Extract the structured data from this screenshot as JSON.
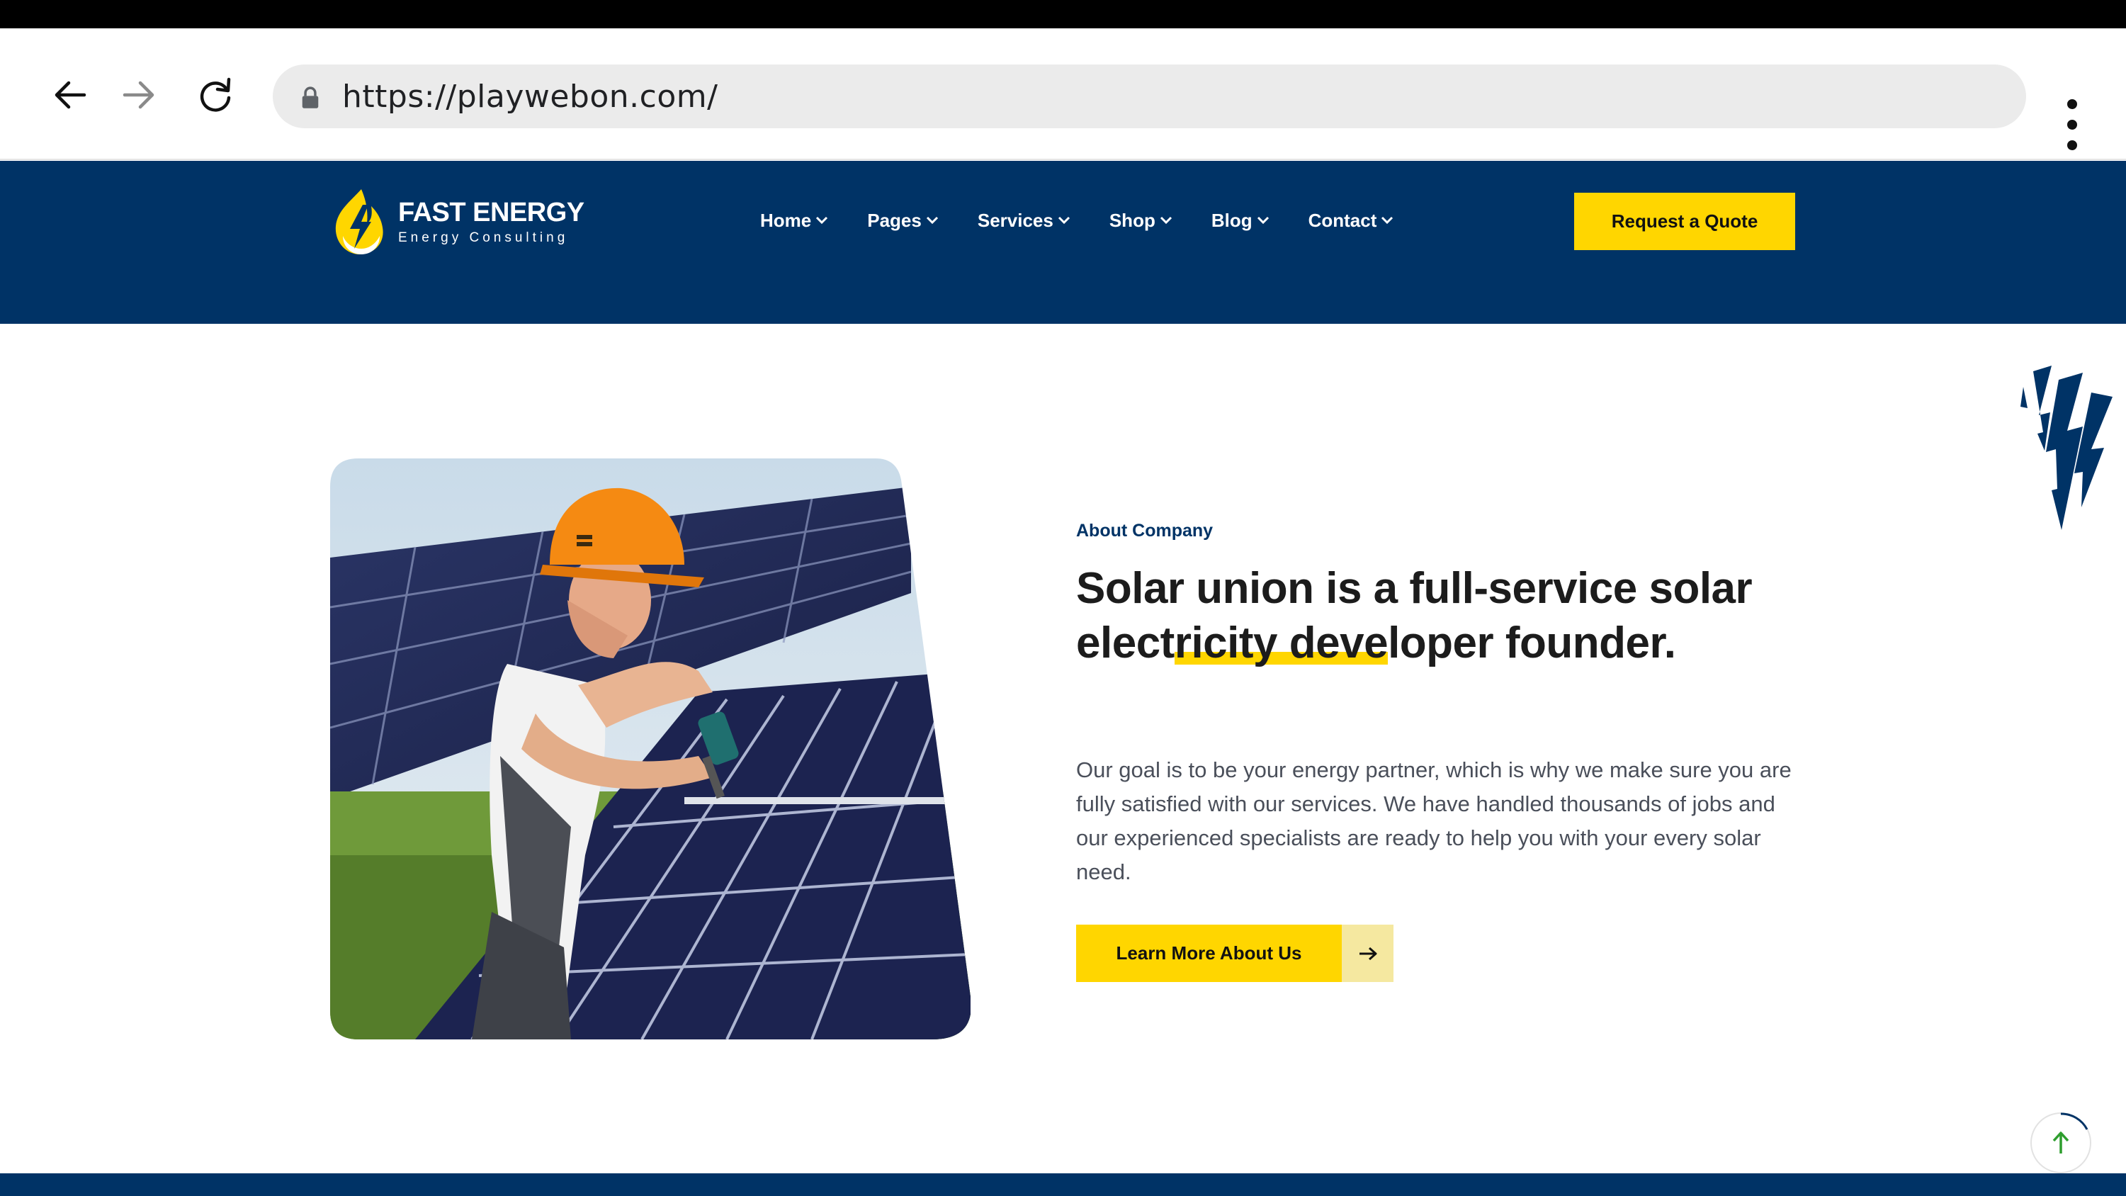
{
  "browser": {
    "url": "https://playwebon.com/",
    "icons": [
      "back-arrow-icon",
      "forward-arrow-icon",
      "reload-icon",
      "lock-icon",
      "menu-dots-icon"
    ]
  },
  "header": {
    "logo_title": "FAST ENERGY",
    "logo_subtitle": "Energy Consulting",
    "nav": [
      {
        "label": "Home"
      },
      {
        "label": "Pages"
      },
      {
        "label": "Services"
      },
      {
        "label": "Shop"
      },
      {
        "label": "Blog"
      },
      {
        "label": "Contact"
      }
    ],
    "quote_button": "Request a Quote"
  },
  "about": {
    "label": "About Company",
    "heading_part1": "Solar union is a full-service solar elect",
    "heading_highlight": "ricity deve",
    "heading_part2": "loper founder.",
    "body": "Our goal is to be your energy partner, which is why we make sure you are fully satisfied with our services. We have handled thousands of jobs and our experienced specialists are ready to help you with your every solar need.",
    "button_label": "Learn More About Us"
  },
  "colors": {
    "navy": "#003366",
    "yellow": "#ffd600",
    "light_yellow": "#f5e8a0",
    "text_dark": "#1c1c1c",
    "text_body": "#4a4f5a",
    "scroll_arrow": "#2e9e2e"
  }
}
